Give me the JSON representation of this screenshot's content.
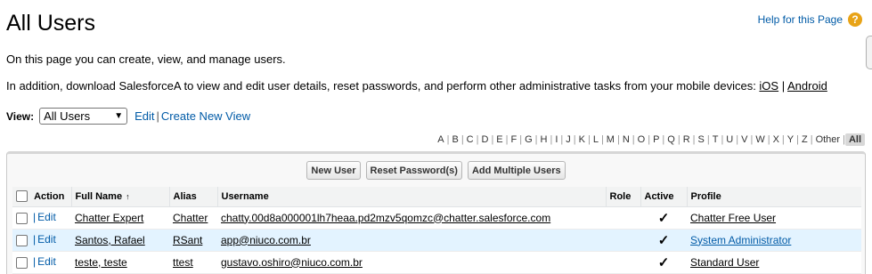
{
  "page": {
    "title": "All Users",
    "help_link": "Help for this Page",
    "help_icon": "help-icon"
  },
  "intro": {
    "line1": "On this page you can create, view, and manage users.",
    "line2_prefix": "In addition, download SalesforceA to view and edit user details, reset passwords, and perform other administrative tasks from your mobile devices: ",
    "ios_link": "iOS",
    "separator": "|",
    "android_link": "Android"
  },
  "view": {
    "label": "View:",
    "selected": "All Users",
    "edit_link": "Edit",
    "create_link": "Create New View"
  },
  "alphabet": [
    "A",
    "B",
    "C",
    "D",
    "E",
    "F",
    "G",
    "H",
    "I",
    "J",
    "K",
    "L",
    "M",
    "N",
    "O",
    "P",
    "Q",
    "R",
    "S",
    "T",
    "U",
    "V",
    "W",
    "X",
    "Y",
    "Z",
    "Other",
    "All"
  ],
  "alphabet_active": "All",
  "buttons": {
    "new_user": "New User",
    "reset_password": "Reset Password(s)",
    "add_multiple": "Add Multiple Users"
  },
  "table": {
    "columns": [
      "Action",
      "Full Name",
      "Alias",
      "Username",
      "Role",
      "Active",
      "Profile"
    ],
    "sort_indicator": "↑",
    "edit_label": "Edit",
    "rows": [
      {
        "full_name": "Chatter Expert",
        "alias": "Chatter",
        "username": "chatty.00d8a000001lh7heaa.pd2mzv5qomzc@chatter.salesforce.com",
        "role": "",
        "active": "✓",
        "profile": "Chatter Free User"
      },
      {
        "full_name": "Santos, Rafael",
        "alias": "RSant",
        "username": "app@niuco.com.br",
        "role": "",
        "active": "✓",
        "profile": "System Administrator"
      },
      {
        "full_name": "teste, teste",
        "alias": "ttest",
        "username": "gustavo.oshiro@niuco.com.br",
        "role": "",
        "active": "✓",
        "profile": "Standard User"
      }
    ]
  },
  "colors": {
    "link": "#015ba7",
    "row_highlight": "#e3f3ff",
    "help_icon_bg": "#e8a317"
  }
}
